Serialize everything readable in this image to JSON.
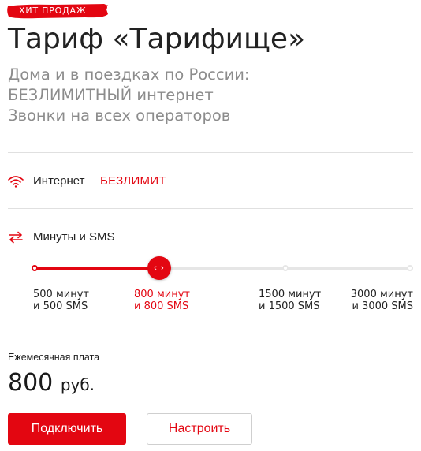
{
  "badge": {
    "text": "ХИТ ПРОДАЖ",
    "color": "#e30611"
  },
  "title": "Тариф «Тарифище»",
  "description": [
    "Дома и в поездках по России:",
    "БЕЗЛИМИТНЫЙ интернет",
    "Звонки на всех операторов"
  ],
  "internet": {
    "icon": "wifi-icon",
    "label": "Интернет",
    "value": "БЕЗЛИМИТ"
  },
  "minutes": {
    "icon": "swap-arrows-icon",
    "label": "Минуты и SMS",
    "slider_thumb": "‹ ›",
    "selected_index": 1,
    "options": [
      {
        "line1": "500 минут",
        "line2": "и 500 SMS"
      },
      {
        "line1": "800 минут",
        "line2": "и 800 SMS"
      },
      {
        "line1": "1500 минут",
        "line2": "и 1500 SMS"
      },
      {
        "line1": "3000 минут",
        "line2": "и 3000 SMS"
      }
    ]
  },
  "fee": {
    "label": "Ежемесячная плата",
    "amount": "800",
    "currency": "руб."
  },
  "buttons": {
    "connect": "Подключить",
    "configure": "Настроить"
  },
  "colors": {
    "accent": "#e30611",
    "muted": "#8c8c8c",
    "divider": "#e0e0e0"
  }
}
